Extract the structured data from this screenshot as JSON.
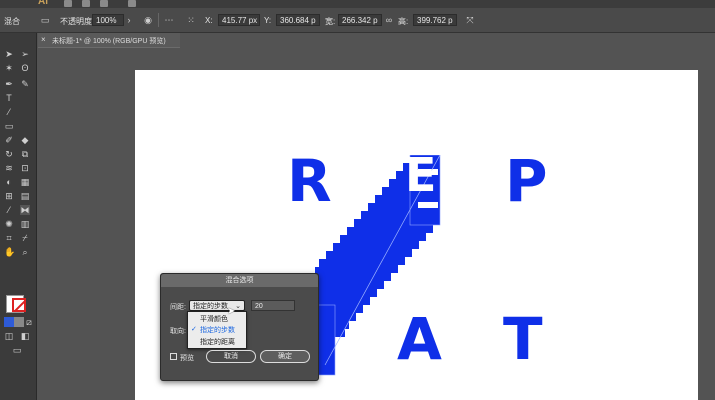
{
  "app": {
    "logo": "Ai"
  },
  "control_bar": {
    "group_label": "混合",
    "opacity_label": "不透明度:",
    "opacity_value": "100%",
    "x_label": "X:",
    "x_value": "415.77 px",
    "y_label": "Y:",
    "y_value": "360.684 p",
    "w_label": "宽:",
    "w_value": "266.342 p",
    "h_label": "高:",
    "h_value": "399.762 p"
  },
  "document_tab": {
    "close": "×",
    "title": "未标题-1* @ 100% (RGB/GPU 预览)"
  },
  "artwork": {
    "letters": [
      "R",
      "E",
      "P",
      "A",
      "T"
    ],
    "fill_color": "#0f2fe8"
  },
  "blend_dialog": {
    "title": "混合选项",
    "spacing_label": "间距:",
    "spacing_selected": "指定的步数",
    "spacing_value": "20",
    "orientation_label": "取向:",
    "menu_items": [
      "平滑颜色",
      "指定的步数",
      "指定的距离"
    ],
    "preview_label": "预览",
    "cancel_label": "取消",
    "ok_label": "确定"
  }
}
